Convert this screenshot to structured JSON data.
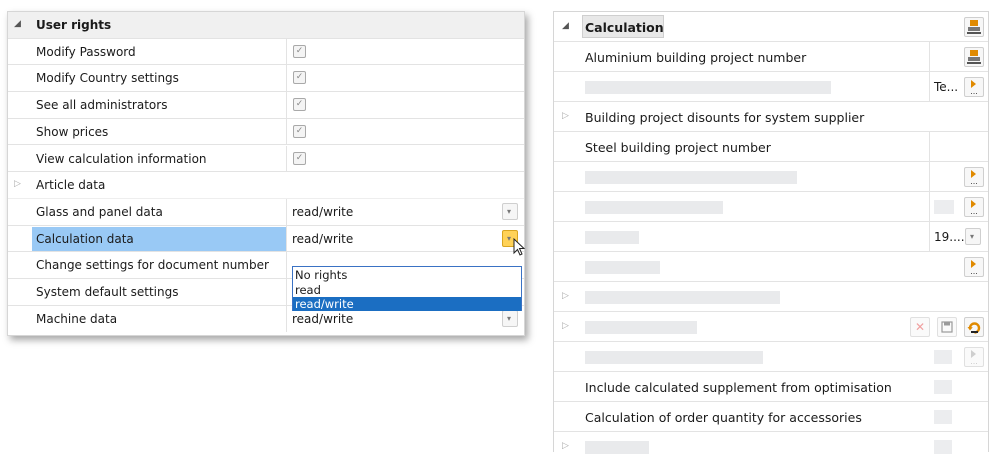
{
  "user_rights": {
    "title": "User rights",
    "rows": [
      {
        "label": "Modify Password",
        "type": "checkbox",
        "checked": true
      },
      {
        "label": "Modify Country settings",
        "type": "checkbox",
        "checked": true
      },
      {
        "label": "See all administrators",
        "type": "checkbox",
        "checked": true
      },
      {
        "label": "Show prices",
        "type": "checkbox",
        "checked": true
      },
      {
        "label": "View calculation information",
        "type": "checkbox",
        "checked": true
      },
      {
        "label": "Article data",
        "type": "group"
      },
      {
        "label": "Glass and panel data",
        "type": "select",
        "value": "read/write"
      },
      {
        "label": "Calculation data",
        "type": "select",
        "value": "read/write",
        "selected": true,
        "open": true
      },
      {
        "label": "Change settings for document number",
        "type": "select",
        "value": ""
      },
      {
        "label": "System default settings",
        "type": "select",
        "value": ""
      },
      {
        "label": "Machine data",
        "type": "select",
        "value": "read/write"
      }
    ],
    "dropdown_options": [
      "No rights",
      "read",
      "read/write"
    ],
    "dropdown_selected": "read/write",
    "check_glyph": "✓",
    "chevron_glyph": "▾"
  },
  "calculation": {
    "title": "Calculation",
    "rows": {
      "r1": {
        "label": "Aluminium building project number"
      },
      "r2": {
        "value": "Te..."
      },
      "r3": {
        "label": "Building project disounts for system supplier"
      },
      "r4": {
        "label": "Steel building project number"
      },
      "r8": {
        "value": "19...."
      },
      "r14": {
        "label": "Include calculated supplement from optimisation"
      },
      "r15": {
        "label": "Calculation of order quantity for accessories"
      }
    },
    "icons": {
      "clear": "✕",
      "save": "💾",
      "lookup_ellipsis": "..."
    }
  },
  "colors": {
    "selection": "#99c9f5",
    "dropdown_highlight": "#1b6ec2",
    "active_button": "#ffd257",
    "accent_orange": "#e08a00"
  }
}
